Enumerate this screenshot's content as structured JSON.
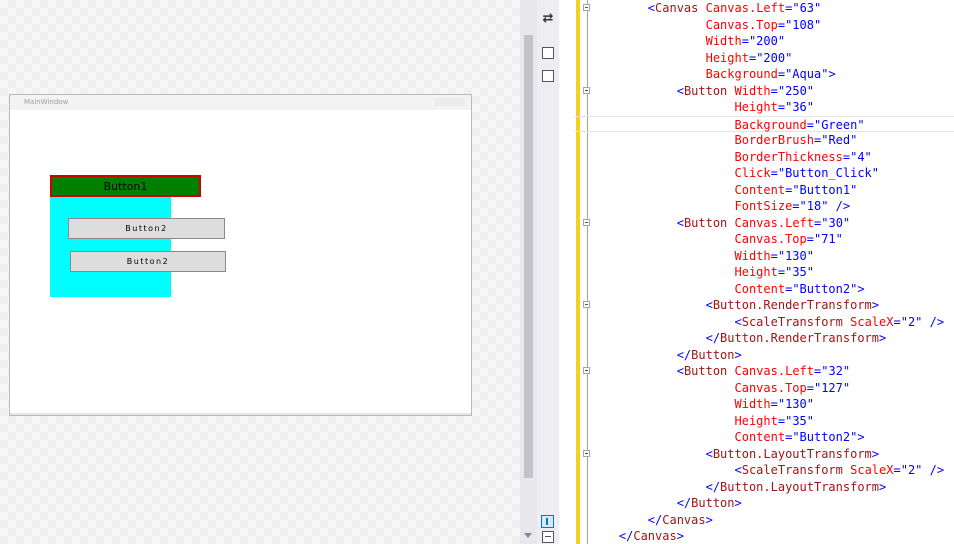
{
  "designer": {
    "window_title": "MainWindow",
    "buttons": {
      "button1": "Button1",
      "button2_render": "Button2",
      "button2_layout": "Button2"
    },
    "colors": {
      "canvas_background": "#00ffff",
      "button1_background": "#008000",
      "button1_border": "#ff0000"
    }
  },
  "toolstrip": {
    "icons": [
      "swap-panes-icon",
      "design-view-icon",
      "xaml-view-icon",
      "vertical-split-icon",
      "horizontal-split-icon"
    ]
  },
  "editor": {
    "lines": [
      {
        "text": "        <Canvas Canvas.Left=\"63\"",
        "fold": true
      },
      {
        "text": "                Canvas.Top=\"108\"",
        "fold": false
      },
      {
        "text": "                Width=\"200\"",
        "fold": false
      },
      {
        "text": "                Height=\"200\"",
        "fold": false
      },
      {
        "text": "                Background=\"Aqua\">",
        "fold": false
      },
      {
        "text": "            <Button Width=\"250\"",
        "fold": true
      },
      {
        "text": "                    Height=\"36\"",
        "fold": false
      },
      {
        "text": "                    Background=\"Green\"",
        "fold": false,
        "current": true
      },
      {
        "text": "                    BorderBrush=\"Red\"",
        "fold": false
      },
      {
        "text": "                    BorderThickness=\"4\"",
        "fold": false
      },
      {
        "text": "                    Click=\"Button_Click\"",
        "fold": false
      },
      {
        "text": "                    Content=\"Button1\"",
        "fold": false
      },
      {
        "text": "                    FontSize=\"18\" />",
        "fold": false
      },
      {
        "text": "            <Button Canvas.Left=\"30\"",
        "fold": true
      },
      {
        "text": "                    Canvas.Top=\"71\"",
        "fold": false
      },
      {
        "text": "                    Width=\"130\"",
        "fold": false
      },
      {
        "text": "                    Height=\"35\"",
        "fold": false
      },
      {
        "text": "                    Content=\"Button2\">",
        "fold": false
      },
      {
        "text": "                <Button.RenderTransform>",
        "fold": true
      },
      {
        "text": "                    <ScaleTransform ScaleX=\"2\" />",
        "fold": false
      },
      {
        "text": "                </Button.RenderTransform>",
        "fold": false
      },
      {
        "text": "            </Button>",
        "fold": false
      },
      {
        "text": "            <Button Canvas.Left=\"32\"",
        "fold": true
      },
      {
        "text": "                    Canvas.Top=\"127\"",
        "fold": false
      },
      {
        "text": "                    Width=\"130\"",
        "fold": false
      },
      {
        "text": "                    Height=\"35\"",
        "fold": false
      },
      {
        "text": "                    Content=\"Button2\">",
        "fold": false
      },
      {
        "text": "                <Button.LayoutTransform>",
        "fold": true
      },
      {
        "text": "                    <ScaleTransform ScaleX=\"2\" />",
        "fold": false
      },
      {
        "text": "                </Button.LayoutTransform>",
        "fold": false
      },
      {
        "text": "            </Button>",
        "fold": false
      },
      {
        "text": "        </Canvas>",
        "fold": false
      },
      {
        "text": "    </Canvas>",
        "fold": false
      }
    ]
  }
}
